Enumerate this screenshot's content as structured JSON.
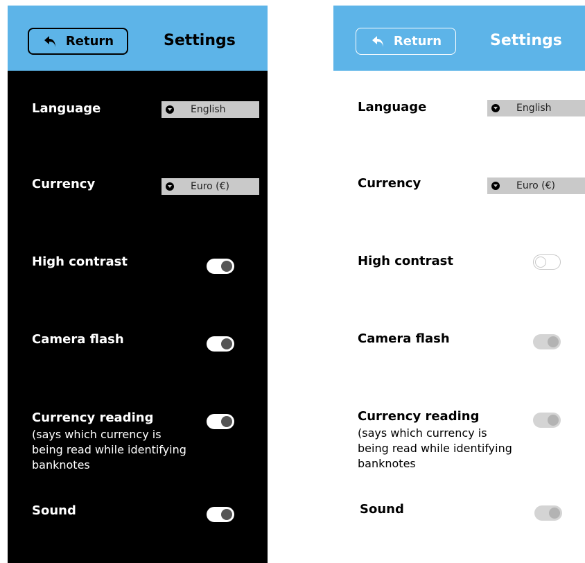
{
  "header": {
    "return_label": "Return",
    "title": "Settings"
  },
  "settings": {
    "language": {
      "label": "Language",
      "value": "English"
    },
    "currency": {
      "label": "Currency",
      "value": "Euro (€)"
    },
    "high_contrast": {
      "label": "High contrast"
    },
    "camera_flash": {
      "label": "Camera flash"
    },
    "currency_reading": {
      "label": "Currency reading",
      "description": "(says which currency is being read while identifying banknotes"
    },
    "sound": {
      "label": "Sound"
    }
  },
  "toggles_dark": {
    "high_contrast": true,
    "camera_flash": true,
    "currency_reading": true,
    "sound": true
  },
  "toggles_light": {
    "high_contrast": false,
    "camera_flash": true,
    "currency_reading": true,
    "sound": true
  },
  "colors": {
    "header_blue": "#5db4e8",
    "dark_bg": "#000000",
    "light_bg": "#ffffff",
    "select_gray": "#c9c9c9"
  },
  "icons": {
    "return": "return-arrow-icon",
    "dropdown": "chevron-down-icon"
  }
}
